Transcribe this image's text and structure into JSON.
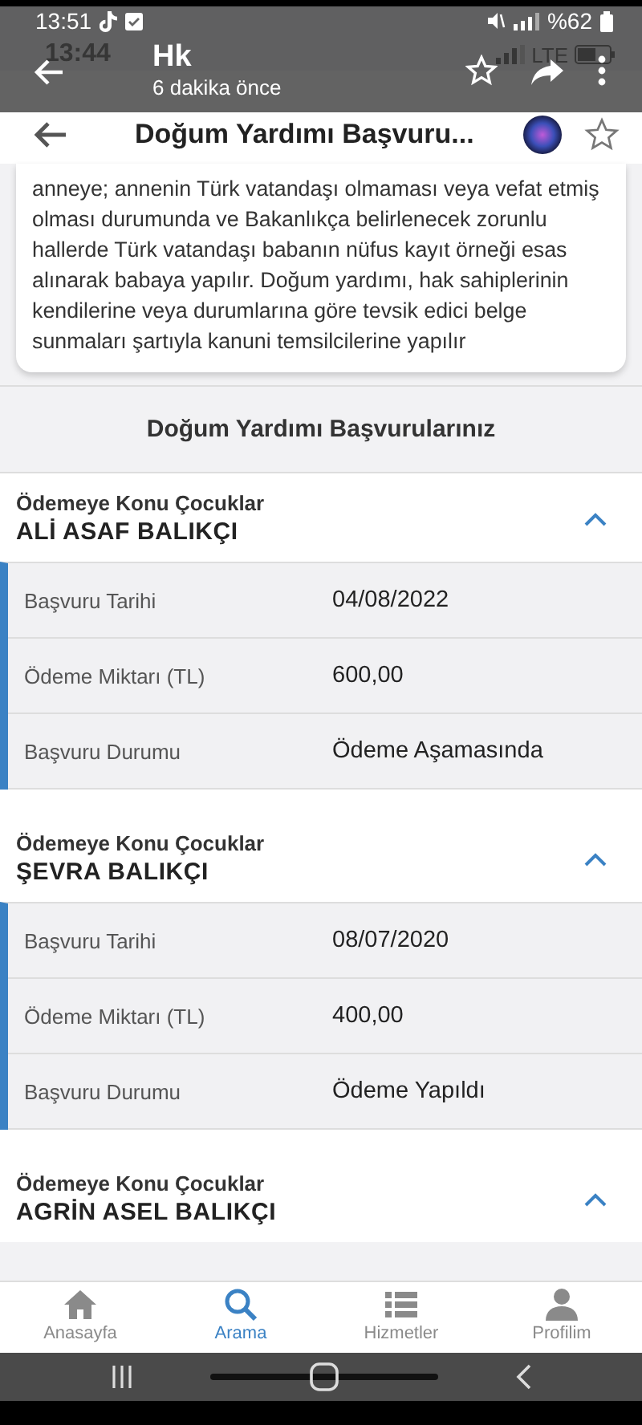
{
  "viewer": {
    "status_time": "13:51",
    "battery": "%62",
    "title": "Hk",
    "subtitle": "6 dakika önce"
  },
  "app": {
    "status_time": "13:44",
    "network": "LTE",
    "title": "Doğum Yardımı Başvuru...",
    "info_text": "anneye; annenin Türk vatandaşı olmaması veya vefat etmiş olması durumunda ve Bakanlıkça belirlenecek zorunlu hallerde Türk vatandaşı babanın nüfus kayıt örneği esas alınarak babaya yapılır. Doğum yardımı, hak sahiplerinin kendilerine veya durumlarına göre tevsik edici belge sunmaları şartıyla kanuni temsilcilerine yapılır",
    "section_title": "Doğum Yardımı Başvurularınız",
    "children": [
      {
        "label": "Ödemeye Konu Çocuklar",
        "name": "ALİ ASAF BALIKÇI",
        "expanded": true,
        "details": [
          {
            "label": "Başvuru Tarihi",
            "value": "04/08/2022"
          },
          {
            "label": "Ödeme Miktarı (TL)",
            "value": "600,00"
          },
          {
            "label": "Başvuru Durumu",
            "value": "Ödeme Aşamasında"
          }
        ]
      },
      {
        "label": "Ödemeye Konu Çocuklar",
        "name": "ŞEVRA BALIKÇI",
        "expanded": true,
        "details": [
          {
            "label": "Başvuru Tarihi",
            "value": "08/07/2020"
          },
          {
            "label": "Ödeme Miktarı (TL)",
            "value": "400,00"
          },
          {
            "label": "Başvuru Durumu",
            "value": "Ödeme Yapıldı"
          }
        ]
      },
      {
        "label": "Ödemeye Konu Çocuklar",
        "name": "AGRİN ASEL BALIKÇI",
        "expanded": true
      }
    ]
  },
  "tabs": [
    {
      "label": "Anasayfa",
      "selected": false
    },
    {
      "label": "Arama",
      "selected": true
    },
    {
      "label": "Hizmetler",
      "selected": false
    },
    {
      "label": "Profilim",
      "selected": false
    }
  ]
}
